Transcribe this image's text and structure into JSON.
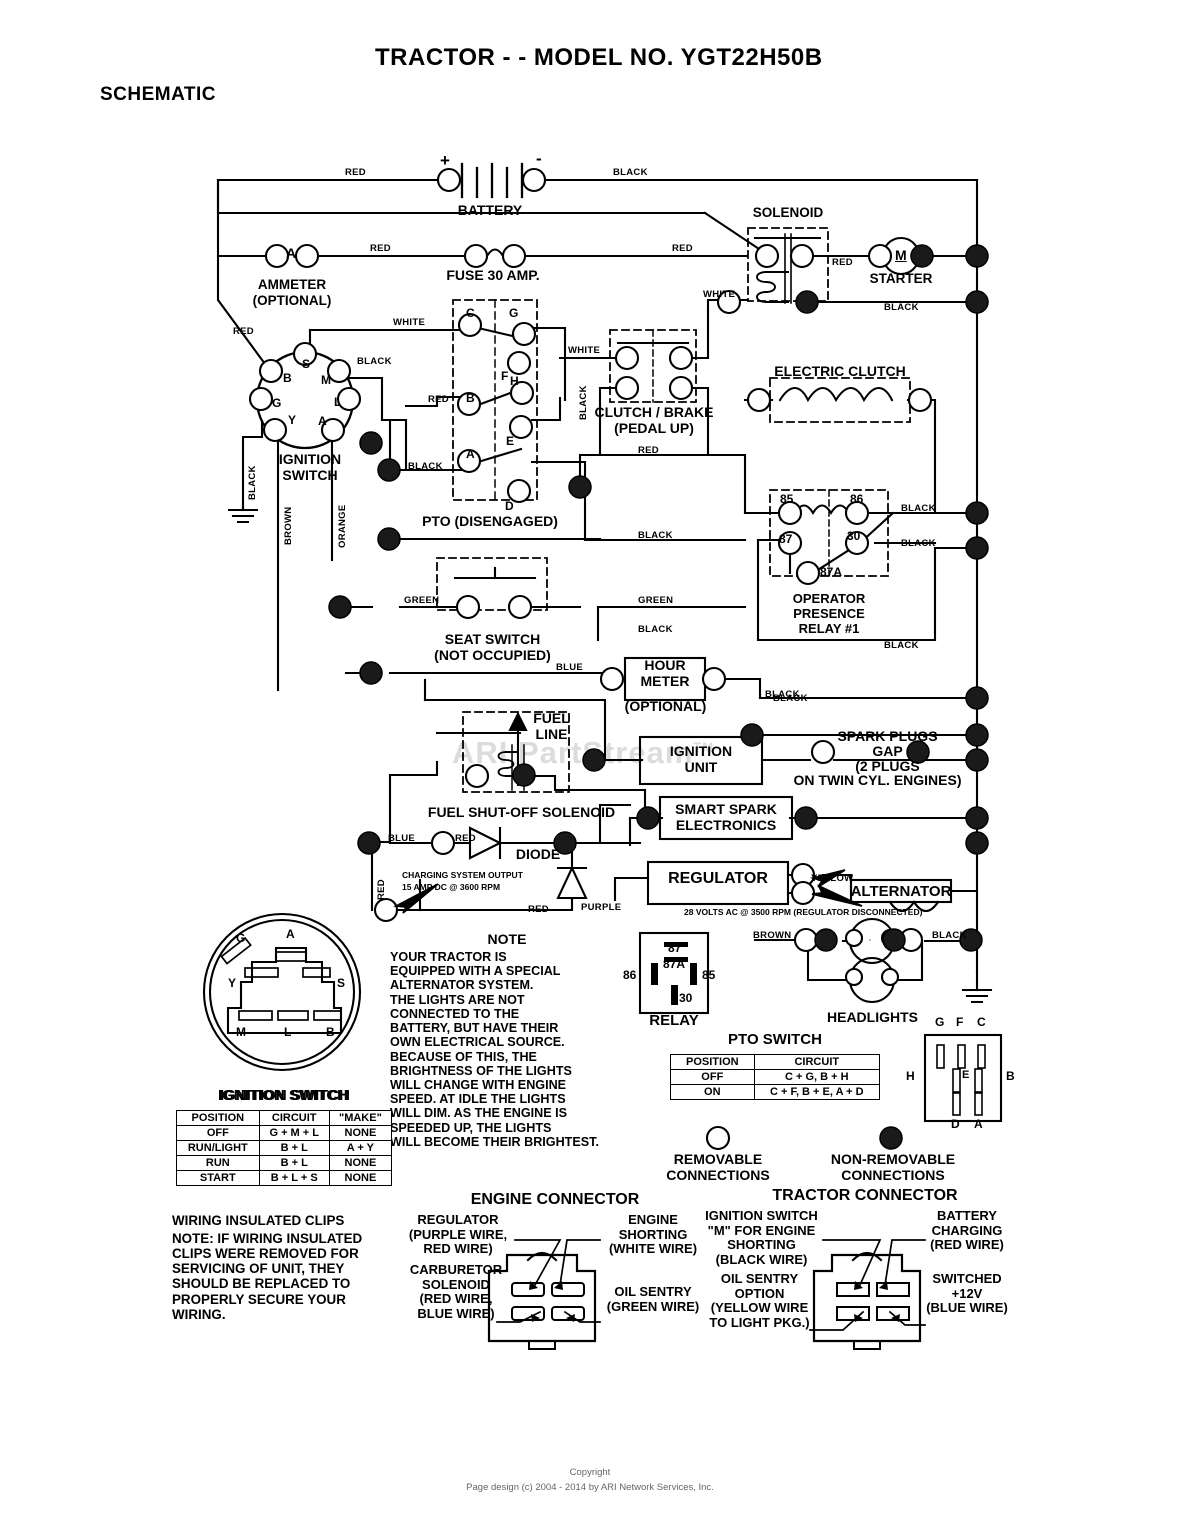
{
  "header": {
    "title": "TRACTOR - - MODEL NO. YGT22H50B",
    "subtitle": "SCHEMATIC"
  },
  "watermark": "ARI PartStream",
  "components": {
    "battery": "BATTERY",
    "battery_plus": "+",
    "battery_minus": "-",
    "ammeter": "AMMETER",
    "ammeter_opt": "(OPTIONAL)",
    "ammeter_symbol": "A",
    "fuse": "FUSE 30 AMP.",
    "solenoid": "SOLENOID",
    "starter": "STARTER",
    "starter_symbol": "M",
    "ignition_switch": "IGNITION",
    "ignition_switch2": "SWITCH",
    "pto": "PTO (DISENGAGED)",
    "clutch_brake": "CLUTCH / BRAKE",
    "clutch_brake2": "(PEDAL UP)",
    "electric_clutch": "ELECTRIC CLUTCH",
    "relay1": "OPERATOR",
    "relay2": "PRESENCE",
    "relay3": "RELAY #1",
    "seat_switch": "SEAT SWITCH",
    "seat_switch2": "(NOT OCCUPIED)",
    "hour_meter1": "HOUR",
    "hour_meter2": "METER",
    "hour_meter_opt": "(OPTIONAL)",
    "fuel_line1": "FUEL",
    "fuel_line2": "LINE",
    "fuel_solenoid": "FUEL SHUT-OFF SOLENOID",
    "diode": "DIODE",
    "ignition_unit1": "IGNITION",
    "ignition_unit2": "UNIT",
    "smart_spark1": "SMART SPARK",
    "smart_spark2": "ELECTRONICS",
    "spark_plugs1": "SPARK PLUGS",
    "spark_plugs2": "GAP",
    "spark_plugs3": "(2 PLUGS",
    "spark_plugs4": "ON TWIN CYL. ENGINES)",
    "regulator": "REGULATOR",
    "alternator": "ALTERNATOR",
    "charging1": "CHARGING SYSTEM OUTPUT",
    "charging2": "15 AMP DC @ 3600 RPM",
    "alt_volts": "28 VOLTS AC @ 3500 RPM (REGULATOR DISCONNECTED)",
    "headlights": "HEADLIGHTS",
    "relay_label": "RELAY"
  },
  "wire_colors": {
    "red": "RED",
    "black": "BLACK",
    "white": "WHITE",
    "green": "GREEN",
    "blue": "BLUE",
    "brown": "BROWN",
    "orange": "ORANGE",
    "purple": "PURPLE",
    "yellow": "YELLOW"
  },
  "ignition_pins": [
    "B",
    "S",
    "M",
    "G",
    "L",
    "Y",
    "A"
  ],
  "pto_pins": [
    "C",
    "G",
    "F",
    "H",
    "B",
    "E",
    "A",
    "D"
  ],
  "relay_pins": [
    "85",
    "86",
    "87",
    "30",
    "87A"
  ],
  "relay_box_pins": [
    "87",
    "87A",
    "86",
    "85",
    "30"
  ],
  "ignition_connector": {
    "caption": "IGNITION SWITCH",
    "pins": [
      "G",
      "A",
      "Y",
      "S",
      "M",
      "L",
      "B"
    ]
  },
  "pto_connector": {
    "top": [
      "G",
      "F",
      "C"
    ],
    "left": "H",
    "right": "B",
    "center": "E",
    "bottom": [
      "D",
      "A"
    ]
  },
  "note": {
    "heading": "NOTE",
    "body": "YOUR TRACTOR IS\nEQUIPPED WITH A SPECIAL\nALTERNATOR SYSTEM.\nTHE LIGHTS ARE NOT\nCONNECTED TO THE\nBATTERY, BUT HAVE THEIR\nOWN ELECTRICAL SOURCE.\nBECAUSE OF THIS, THE\nBRIGHTNESS OF THE LIGHTS\nWILL CHANGE WITH ENGINE\nSPEED.  AT IDLE THE LIGHTS\nWILL DIM.  AS THE ENGINE IS\nSPEEDED UP, THE LIGHTS\nWILL BECOME THEIR BRIGHTEST."
  },
  "clips_note": {
    "heading": "WIRING INSULATED CLIPS",
    "body": "NOTE: IF WIRING INSULATED\nCLIPS WERE REMOVED FOR\nSERVICING OF UNIT, THEY\nSHOULD BE REPLACED TO\nPROPERLY SECURE YOUR\nWIRING."
  },
  "ignition_table": {
    "caption": "IGNITION SWITCH",
    "headers": [
      "POSITION",
      "CIRCUIT",
      "\"MAKE\""
    ],
    "rows": [
      [
        "OFF",
        "G + M + L",
        "NONE"
      ],
      [
        "RUN/LIGHT",
        "B + L",
        "A + Y"
      ],
      [
        "RUN",
        "B + L",
        "NONE"
      ],
      [
        "START",
        "B + L + S",
        "NONE"
      ]
    ]
  },
  "pto_table": {
    "caption": "PTO SWITCH",
    "headers": [
      "POSITION",
      "CIRCUIT"
    ],
    "rows": [
      [
        "OFF",
        "C + G, B + H"
      ],
      [
        "ON",
        "C + F, B + E, A + D"
      ]
    ]
  },
  "legend": {
    "removable1": "REMOVABLE",
    "removable2": "CONNECTIONS",
    "nonremovable1": "NON-REMOVABLE",
    "nonremovable2": "CONNECTIONS"
  },
  "engine_connector": {
    "title": "ENGINE CONNECTOR",
    "tl": "REGULATOR\n(PURPLE WIRE,\nRED WIRE)",
    "bl": "CARBURETOR\nSOLENOID\n(RED WIRE,\nBLUE WIRE)",
    "tr": "ENGINE\nSHORTING\n(WHITE WIRE)",
    "br": "OIL SENTRY\n(GREEN WIRE)"
  },
  "tractor_connector": {
    "title": "TRACTOR CONNECTOR",
    "tl": "IGNITION SWITCH\n\"M\" FOR ENGINE\nSHORTING\n(BLACK WIRE)",
    "bl": "OIL SENTRY\nOPTION\n(YELLOW WIRE\nTO LIGHT PKG.)",
    "tr": "BATTERY\nCHARGING\n(RED WIRE)",
    "br": "SWITCHED\n+12V\n(BLUE WIRE)"
  },
  "footer": {
    "line1": "Copyright",
    "line2": "Page design (c) 2004 - 2014 by ARI Network Services, Inc."
  },
  "colors": {
    "ink": "#000000",
    "paper": "#ffffff",
    "watermark": "#dcdcdc",
    "footer": "#666666"
  }
}
